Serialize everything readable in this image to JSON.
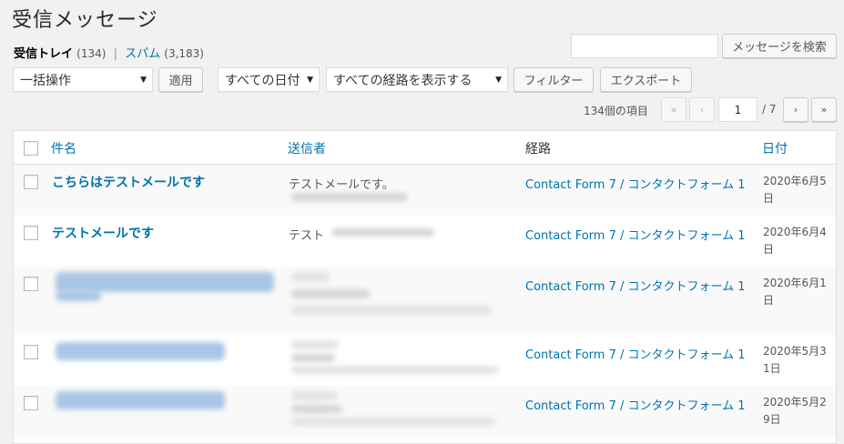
{
  "page_title": "受信メッセージ",
  "views": {
    "inbox_label": "受信トレイ",
    "inbox_count": "(134)",
    "separator": "|",
    "spam_label": "スパム",
    "spam_count": "(3,183)"
  },
  "search": {
    "value": "",
    "button_label": "メッセージを検索"
  },
  "bulk": {
    "selected": "一括操作",
    "apply_label": "適用"
  },
  "filters": {
    "date_selected": "すべての日付",
    "channel_selected": "すべての経路を表示する",
    "filter_label": "フィルター",
    "export_label": "エクスポート"
  },
  "pagination": {
    "items": "134個の項目",
    "first": "«",
    "prev": "‹",
    "current_page": "1",
    "total": "/ 7",
    "next": "›",
    "last": "»"
  },
  "table": {
    "headers": {
      "subject": "件名",
      "sender": "送信者",
      "channel": "経路",
      "date": "日付"
    },
    "rows": [
      {
        "subject": "こちらはテストメールです",
        "sender": "テストメールです。",
        "channel": "Contact Form 7 / コンタクトフォーム 1",
        "date": "2020年6月5日"
      },
      {
        "subject": "テストメールです",
        "sender": "テスト",
        "channel": "Contact Form 7 / コンタクトフォーム 1",
        "date": "2020年6月4日"
      },
      {
        "subject": "",
        "sender": "",
        "channel": "Contact Form 7 / コンタクトフォーム 1",
        "date": "2020年6月1日"
      },
      {
        "subject": "",
        "sender": "",
        "channel": "Contact Form 7 / コンタクトフォーム 1",
        "date": "2020年5月31日"
      },
      {
        "subject": "",
        "sender": "",
        "channel": "Contact Form 7 / コンタクトフォーム 1",
        "date": "2020年5月29日"
      }
    ]
  }
}
